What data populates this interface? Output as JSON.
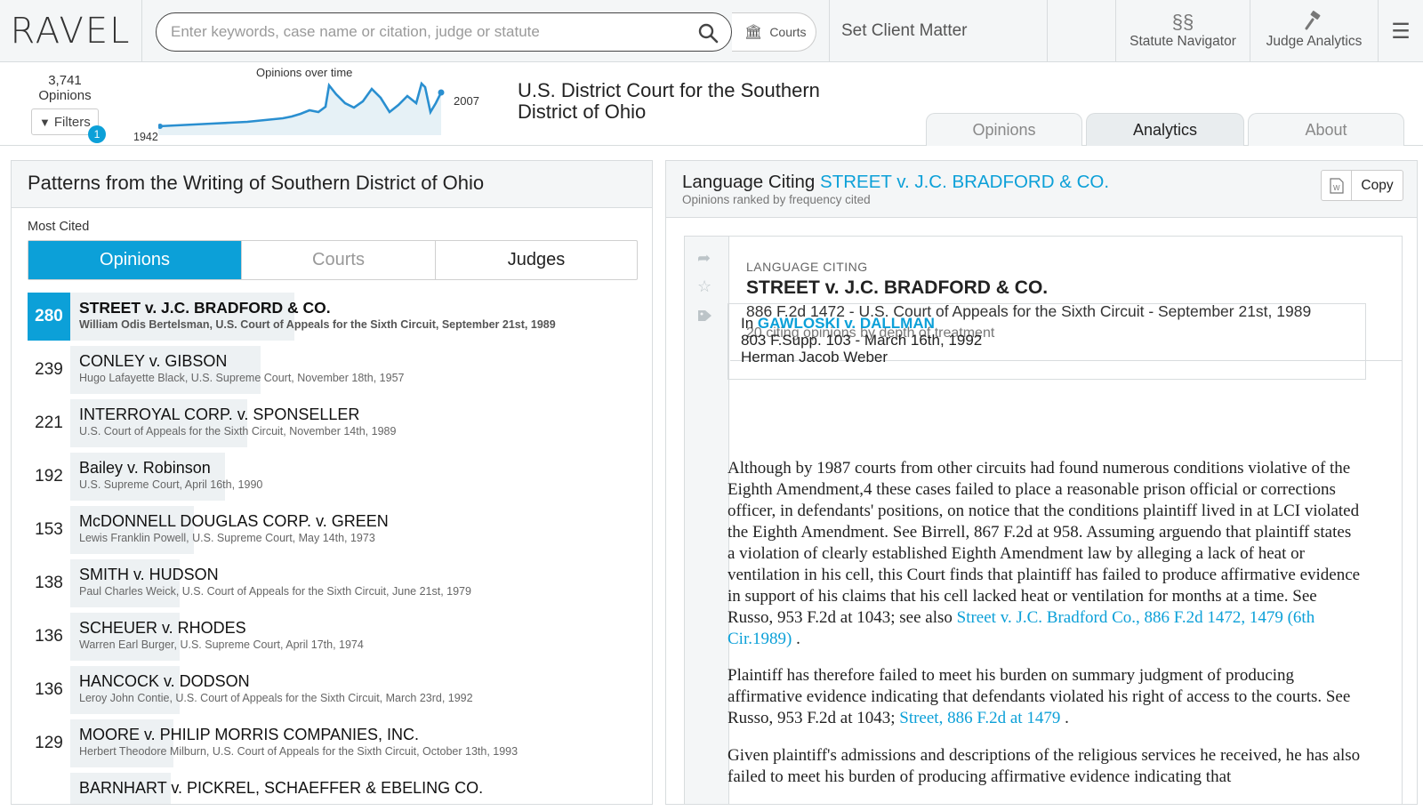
{
  "nav": {
    "logo": "RAVEL",
    "search_placeholder": "Enter keywords, case name or citation, judge or statute",
    "courts_label": "Courts",
    "client_matter": "Set Client Matter",
    "statute_navigator": "Statute Navigator",
    "statute_icon": "§§",
    "judge_analytics": "Judge Analytics"
  },
  "court": {
    "opinion_count": "3,741",
    "opinion_label": "Opinions",
    "filters_label": "Filters",
    "filter_badge": "1",
    "sparkline_title": "Opinions over time",
    "year_start": "1942",
    "year_end": "2007",
    "name": "U.S. District Court for the Southern District of Ohio",
    "tabs": [
      {
        "label": "Opinions",
        "active": false
      },
      {
        "label": "Analytics",
        "active": true
      },
      {
        "label": "About",
        "active": false
      }
    ]
  },
  "left": {
    "title": "Patterns from the Writing of Southern District of Ohio",
    "most_cited": "Most Cited",
    "segments": [
      "Opinions",
      "Courts",
      "Judges"
    ],
    "active_segment": "Opinions",
    "cases": [
      {
        "count": "280",
        "name": "STREET v. J.C. BRADFORD & CO.",
        "meta": "William Odis Bertelsman, U.S. Court of Appeals for the Sixth Circuit, September 21st, 1989",
        "share": 1.0
      },
      {
        "count": "239",
        "name": "CONLEY v. GIBSON",
        "meta": "Hugo Lafayette Black, U.S. Supreme Court, November 18th, 1957",
        "share": 0.85
      },
      {
        "count": "221",
        "name": "INTERROYAL CORP. v. SPONSELLER",
        "meta": "U.S. Court of Appeals for the Sixth Circuit, November 14th, 1989",
        "share": 0.79
      },
      {
        "count": "192",
        "name": "Bailey v. Robinson",
        "meta": "U.S. Supreme Court, April 16th, 1990",
        "share": 0.69
      },
      {
        "count": "153",
        "name": "McDONNELL DOUGLAS CORP. v. GREEN",
        "meta": "Lewis Franklin Powell, U.S. Supreme Court, May 14th, 1973",
        "share": 0.55
      },
      {
        "count": "138",
        "name": "SMITH v. HUDSON",
        "meta": "Paul Charles Weick, U.S. Court of Appeals for the Sixth Circuit, June 21st, 1979",
        "share": 0.49
      },
      {
        "count": "136",
        "name": "SCHEUER v. RHODES",
        "meta": "Warren Earl Burger, U.S. Supreme Court, April 17th, 1974",
        "share": 0.49
      },
      {
        "count": "136",
        "name": "HANCOCK v. DODSON",
        "meta": "Leroy John Contie, U.S. Court of Appeals for the Sixth Circuit, March 23rd, 1992",
        "share": 0.49
      },
      {
        "count": "129",
        "name": "MOORE v. PHILIP MORRIS COMPANIES, INC.",
        "meta": "Herbert Theodore Milburn, U.S. Court of Appeals for the Sixth Circuit, October 13th, 1993",
        "share": 0.46
      },
      {
        "count": "",
        "name": "BARNHART v. PICKREL, SCHAEFFER & EBELING CO.",
        "meta": "",
        "share": 0.45
      }
    ]
  },
  "right": {
    "title_prefix": "Language Citing",
    "title_case": "STREET v. J.C. BRADFORD & CO.",
    "subtitle": "Opinions ranked by frequency cited",
    "copy_label": "Copy",
    "copy_icon": "W",
    "rail_icons": [
      "share-icon",
      "star-icon",
      "tag-icon"
    ],
    "lc_label": "LANGUAGE CITING",
    "lc_case": "STREET v. J.C. BRADFORD & CO.",
    "lc_cite": "886 F.2d 1472 - U.S. Court of Appeals for the Sixth Circuit - September 21st, 1989",
    "lc_count": "20 citing opinions by depth of treatment",
    "in_prefix": "In",
    "in_case": "GAWLOSKI v. DALLMAN",
    "in_cite": "803 F.Supp. 103 - March 16th, 1992",
    "in_judge": "Herman Jacob Weber",
    "para1": "Although by 1987 courts from other circuits had found numerous conditions violative of the Eighth Amendment,4 these cases failed to place a reasonable prison official or corrections officer, in defendants' positions, on notice that the conditions plaintiff lived in at LCI violated the Eighth Amendment. See Birrell, 867 F.2d at 958. Assuming arguendo that plaintiff states a violation of clearly established Eighth Amendment law by alleging a lack of heat or ventilation in his cell, this Court finds that plaintiff has failed to produce affirmative evidence in support of his claims that his cell lacked heat or ventilation for months at a time. See Russo, 953 F.2d at 1043; see also",
    "para1_link": "Street v. J.C. Bradford Co., 886 F.2d 1472, 1479 (6th Cir.1989)",
    "para1_end": " .",
    "para2": "Plaintiff has therefore failed to meet his burden on summary judgment of producing affirmative evidence indicating that defendants violated his right of access to the courts. See Russo, 953 F.2d at 1043;",
    "para2_link": "Street, 886 F.2d at 1479",
    "para2_end": " .",
    "para3": "Given plaintiff's admissions and descriptions of the religious services he received, he has also failed to meet his burden of producing affirmative evidence indicating that"
  },
  "colors": {
    "accent": "#0ca0d8",
    "panel_bg": "#f4f6f7",
    "border": "#d8dcde"
  }
}
